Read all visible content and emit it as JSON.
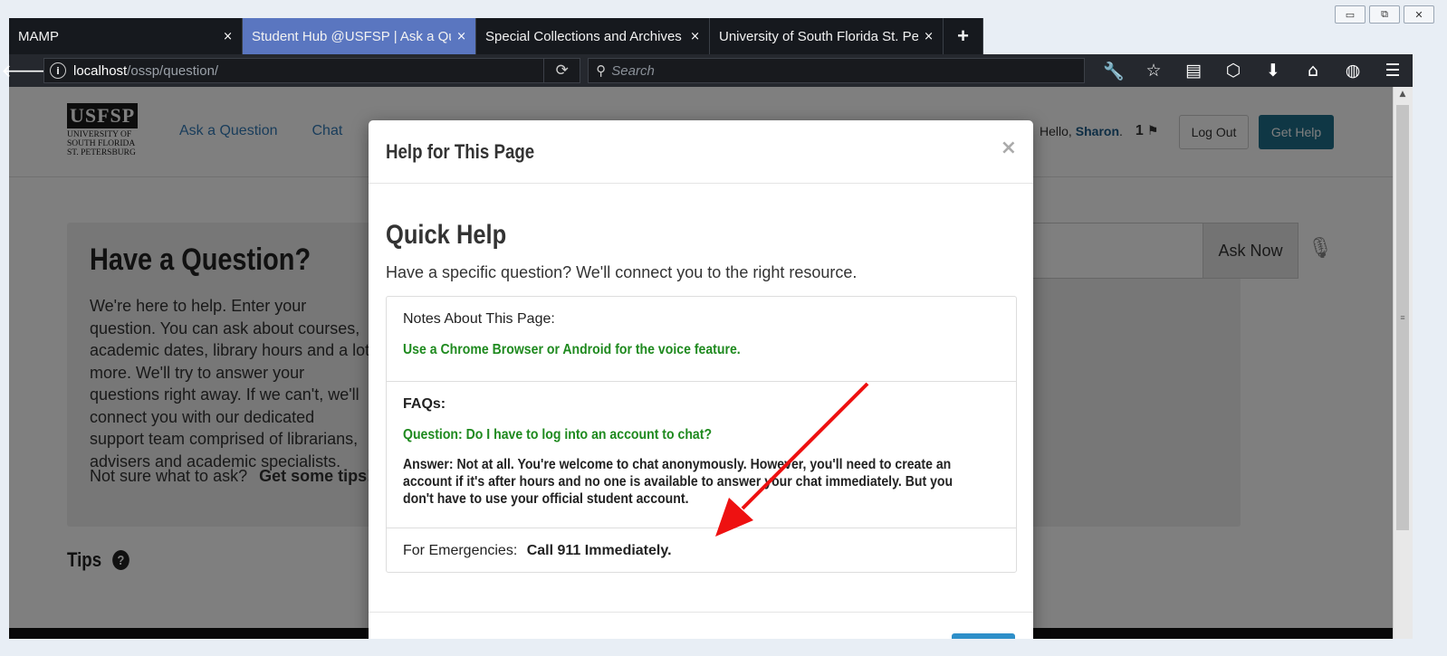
{
  "window": {
    "minimize_glyph": "▭",
    "maximize_glyph": "⧉",
    "close_glyph": "✕"
  },
  "tabs": [
    {
      "title": "MAMP",
      "close": "×"
    },
    {
      "title": "Student Hub @USFSP | Ask a Question",
      "close": "×"
    },
    {
      "title": "Special Collections and Archives | USFSP",
      "close": "×"
    },
    {
      "title": "University of South Florida St. Petersburg",
      "close": "×"
    }
  ],
  "new_tab": "+",
  "navbar": {
    "back": "🡐",
    "info": "i",
    "url_host": "localhost",
    "url_path": "/ossp/question/",
    "reload": "⟳",
    "search_placeholder": "Search",
    "search_glyph": "⚲",
    "toolbar_icons": [
      "wrench-icon",
      "star-icon",
      "reader-icon",
      "pocket-icon",
      "download-icon",
      "home-icon",
      "globe-icon",
      "menu-icon"
    ],
    "toolbar_glyphs": [
      "🔧",
      "☆",
      "▤",
      "⬡",
      "⬇",
      "⌂",
      "◍",
      "☰"
    ]
  },
  "site": {
    "logo_mark": "USFSP",
    "logo_lines": [
      "UNIVERSITY OF",
      "SOUTH FLORIDA",
      "ST. PETERSBURG"
    ],
    "nav": [
      "Ask a Question",
      "Chat"
    ],
    "hello": "Hello,",
    "user": "Sharon",
    "user_suffix": ".",
    "flag_count": "1",
    "flag_glyph": "⚑",
    "logout": "Log Out",
    "get_help": "Get Help"
  },
  "hero": {
    "title": "Have a Question?",
    "text": "We're here to help. Enter your question. You can ask about courses, academic dates, library hours and a lot more. We'll try to answer your questions right away. If we can't, we'll connect you with our dedicated support team comprised of librarians, advisers and academic specialists.",
    "tips_prompt": "Not sure what to ask?",
    "tips_link": "Get some tips!",
    "ask_button": "Ask Now",
    "mic_glyph": "🎙"
  },
  "tips": {
    "heading": "Tips",
    "icon": "?"
  },
  "modal": {
    "title": "Help for This Page",
    "close": "×",
    "quick_help": "Quick Help",
    "subtitle": "Have a specific question? We'll connect you to the right resource.",
    "notes_label": "Notes About This Page:",
    "notes_text": "Use a Chrome Browser or Android for the voice feature.",
    "faqs_label": "FAQs:",
    "faq_question": "Question: Do I have to log into an account to chat?",
    "faq_answer": "Answer: Not at all. You're welcome to chat anonymously. However, you'll need to create an account if it's after hours and no one is available to answer your chat immediately. But you don't have to use your official student account.",
    "emergency_label": "For Emergencies:",
    "emergency_text": "Call 911 Immediately."
  },
  "colors": {
    "annotation_arrow": "#ee1111",
    "faq_green": "#1f8a1f",
    "active_tab": "#5a76c0",
    "get_help_button": "#1f6f8b"
  }
}
